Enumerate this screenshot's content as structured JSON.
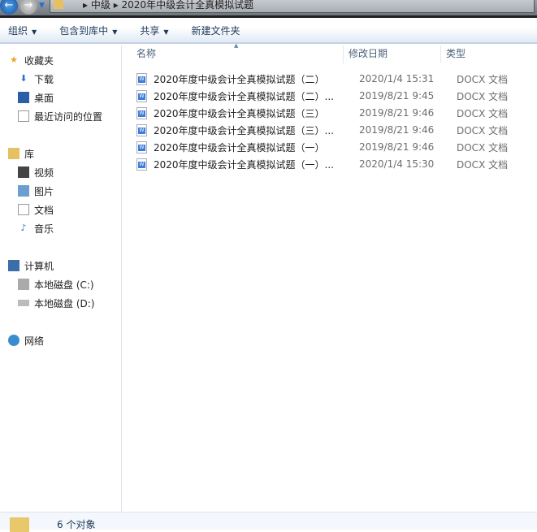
{
  "address": {
    "breadcrumbs": [
      "中级",
      "2020年中级会计全真模拟试题"
    ]
  },
  "toolbar": {
    "organize": "组织",
    "include_library": "包含到库中",
    "share": "共享",
    "new_folder": "新建文件夹"
  },
  "sidebar": {
    "favorites": "收藏夹",
    "downloads": "下载",
    "desktop": "桌面",
    "recent": "最近访问的位置",
    "libraries": "库",
    "videos": "视频",
    "pictures": "图片",
    "documents": "文档",
    "music": "音乐",
    "computer": "计算机",
    "drive_c": "本地磁盘 (C:)",
    "drive_d": "本地磁盘 (D:)",
    "network": "网络"
  },
  "columns": {
    "name": "名称",
    "date": "修改日期",
    "type": "类型"
  },
  "files": [
    {
      "name": "2020年度中级会计全真模拟试题（二）",
      "date": "2020/1/4 15:31",
      "type": "DOCX 文档"
    },
    {
      "name": "2020年度中级会计全真模拟试题（二）...",
      "date": "2019/8/21 9:45",
      "type": "DOCX 文档"
    },
    {
      "name": "2020年度中级会计全真模拟试题（三）",
      "date": "2019/8/21 9:46",
      "type": "DOCX 文档"
    },
    {
      "name": "2020年度中级会计全真模拟试题（三）...",
      "date": "2019/8/21 9:46",
      "type": "DOCX 文档"
    },
    {
      "name": "2020年度中级会计全真模拟试题（一）",
      "date": "2019/8/21 9:46",
      "type": "DOCX 文档"
    },
    {
      "name": "2020年度中级会计全真模拟试题（一）...",
      "date": "2020/1/4 15:30",
      "type": "DOCX 文档"
    }
  ],
  "status": {
    "count": "6 个对象"
  }
}
